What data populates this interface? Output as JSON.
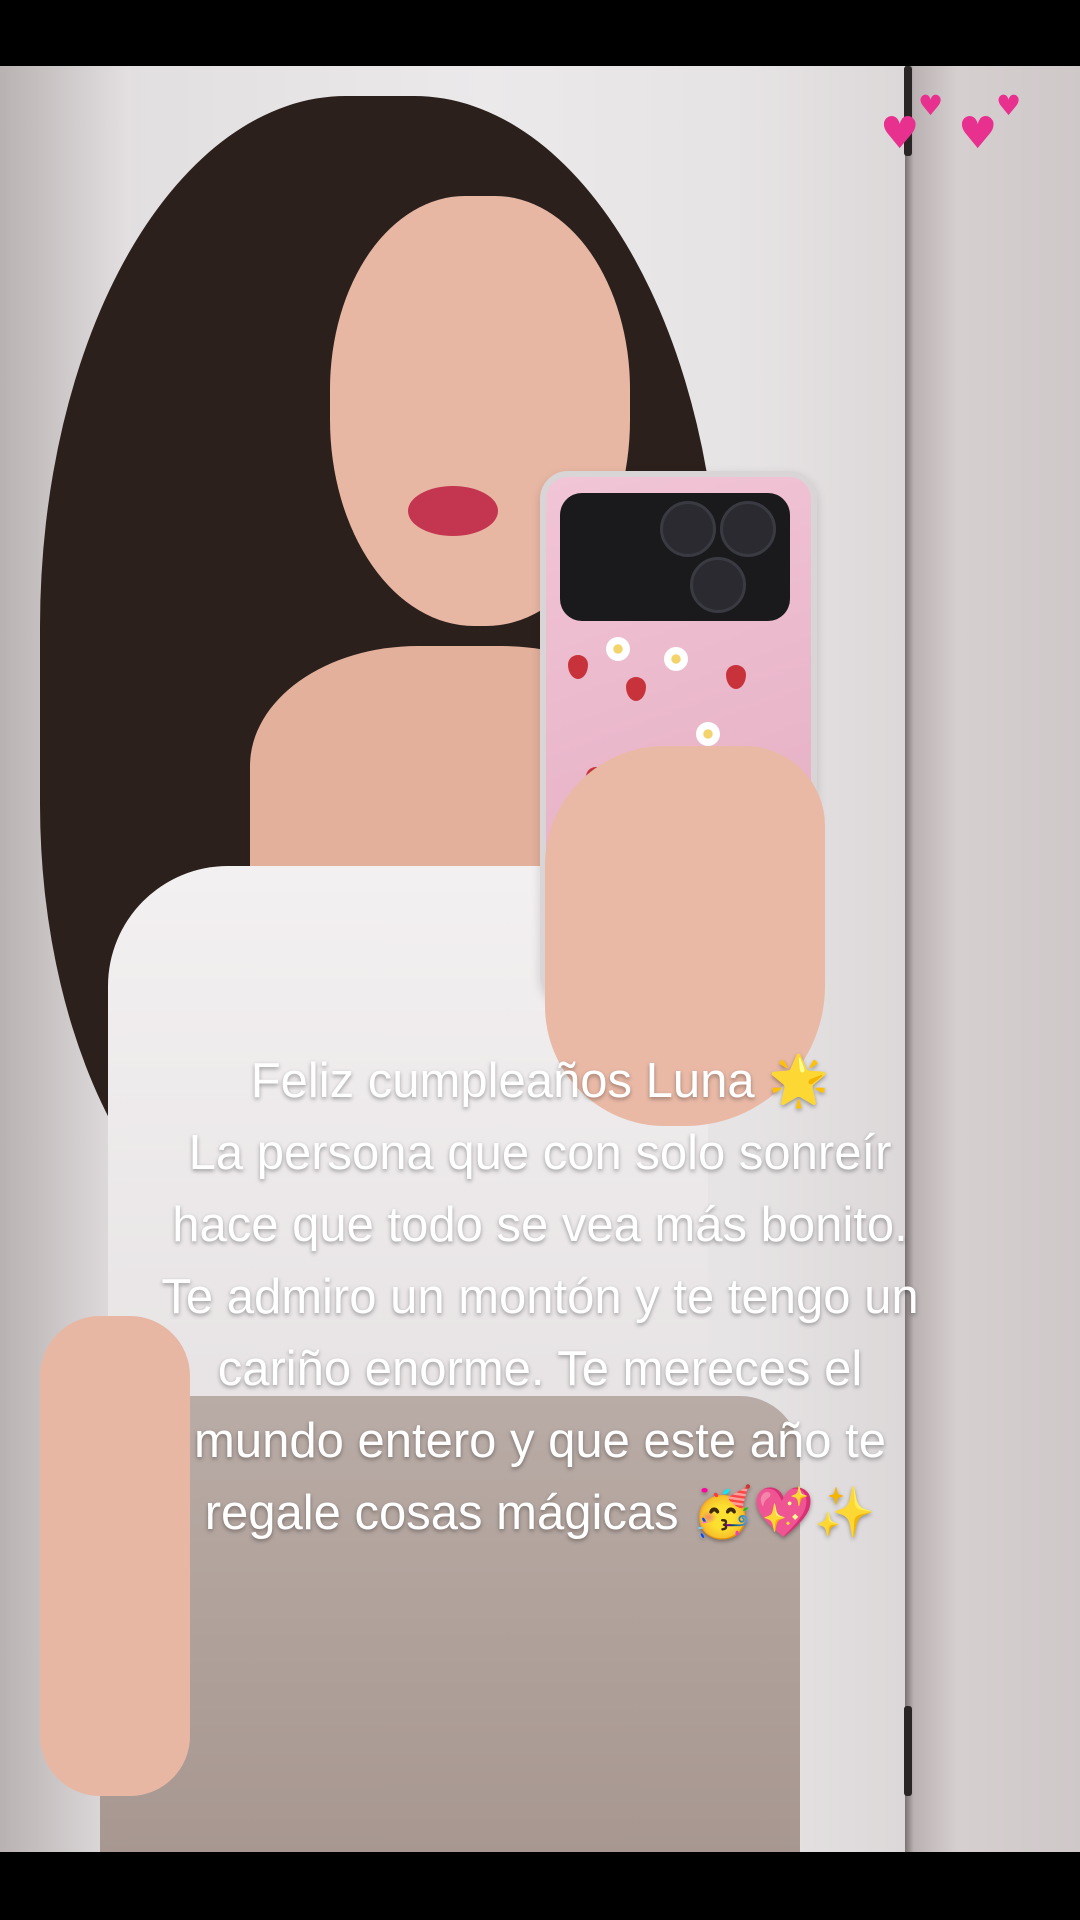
{
  "caption": {
    "line1": "Feliz cumpleaños Luna",
    "line1_emoji": "🌟",
    "line2": "La persona que con solo sonreír",
    "line3": "hace que todo se vea más bonito.",
    "line4": "Te admiro un montón y te tengo un",
    "line5": "cariño enorme. Te mereces el",
    "line6": "mundo entero y que este año te",
    "line7": "regale cosas mágicas",
    "line7_emoji": "🥳💖✨"
  },
  "sticker": {
    "icon": "two-hearts-icon",
    "glyph": "💕",
    "color": "#e8308f"
  },
  "colors": {
    "caption_text": "#ffffff",
    "letterbox": "#000000",
    "phone_case": "#eab4c8"
  }
}
